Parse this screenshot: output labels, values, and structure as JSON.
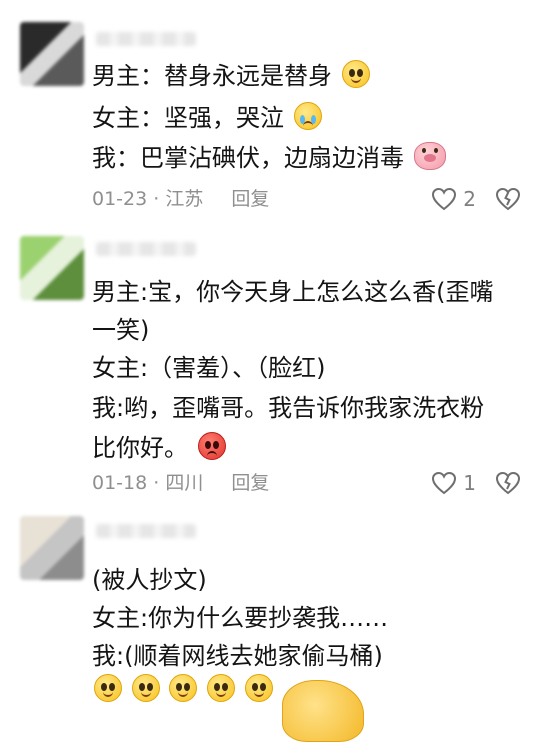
{
  "comments": [
    {
      "lines": [
        "男主：替身永远是替身",
        "女主：坚强，哭泣",
        "我：巴掌沾碘伏，边扇边消毒"
      ],
      "date": "01-23",
      "location": "江苏",
      "reply": "回复",
      "likes": "2"
    },
    {
      "lines": [
        "男主:宝，你今天身上怎么这么香(歪嘴",
        "一笑)",
        " 女主:（害羞）、（脸红)",
        "我:哟，歪嘴哥。我告诉你我家洗衣粉",
        "比你好。"
      ],
      "date": "01-18",
      "location": "四川",
      "reply": "回复",
      "likes": "1"
    },
    {
      "lines": [
        "(被人抄文)",
        "女主:你为什么要抄袭我……",
        "我:(顺着网线去她家偷马桶)"
      ]
    }
  ],
  "icons": {
    "like": "heart-outline-icon",
    "dislike": "broken-heart-icon",
    "emoji_smile": "smiling-face-emoji",
    "emoji_cry": "crying-face-emoji",
    "emoji_pig": "pig-face-emoji",
    "emoji_angry": "angry-face-emoji"
  },
  "colors": {
    "text": "#141414",
    "meta": "#8f8f8f",
    "background": "#ffffff"
  }
}
